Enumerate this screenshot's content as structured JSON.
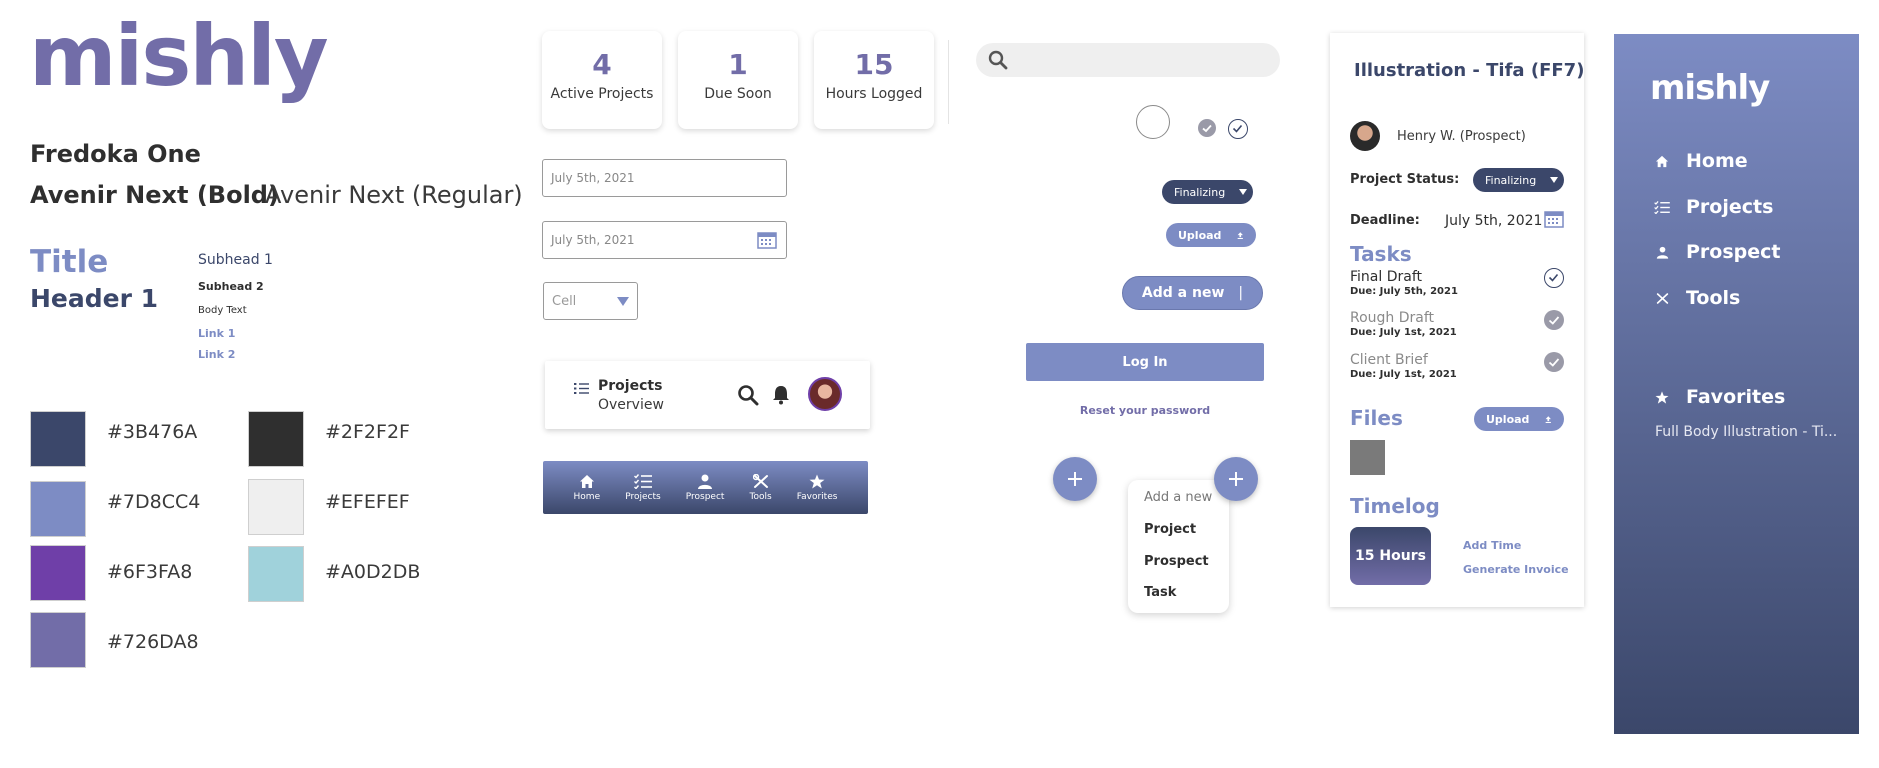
{
  "styleguide": {
    "logo": "mishly",
    "fonts": {
      "display": "Fredoka One",
      "bold": "Avenir Next (Bold)",
      "regular": "Avenir Next (Regular)"
    },
    "type": {
      "title": "Title",
      "header1": "Header 1",
      "subhead1": "Subhead 1",
      "subhead2": "Subhead 2",
      "body": "Body Text",
      "link1": "Link 1",
      "link2": "Link 2"
    },
    "colors": [
      {
        "hex": "#3B476A",
        "label": "#3B476A"
      },
      {
        "hex": "#7D8CC4",
        "label": "#7D8CC4"
      },
      {
        "hex": "#6F3FA8",
        "label": "#6F3FA8"
      },
      {
        "hex": "#726DA8",
        "label": "#726DA8"
      },
      {
        "hex": "#2F2F2F",
        "label": "#2F2F2F"
      },
      {
        "hex": "#EFEFEF",
        "label": "#EFEFEF"
      },
      {
        "hex": "#A0D2DB",
        "label": "#A0D2DB"
      }
    ]
  },
  "stats": [
    {
      "value": "4",
      "label": "Active Projects"
    },
    {
      "value": "1",
      "label": "Due Soon"
    },
    {
      "value": "15",
      "label": "Hours Logged"
    }
  ],
  "inputs": {
    "date_value": "July 5th, 2021",
    "date_picker_value": "July 5th, 2021",
    "select_value": "Cell"
  },
  "mobile_header": {
    "title": "Projects",
    "subtitle": "Overview"
  },
  "bottom_nav": [
    {
      "label": "Home",
      "icon": "home-icon"
    },
    {
      "label": "Projects",
      "icon": "list-icon"
    },
    {
      "label": "Prospect",
      "icon": "person-icon"
    },
    {
      "label": "Tools",
      "icon": "tools-icon"
    },
    {
      "label": "Favorites",
      "icon": "star-icon"
    }
  ],
  "components": {
    "status_pill": "Finalizing",
    "upload_pill": "Upload",
    "add_new_button": "Add a new",
    "login_button": "Log In",
    "reset_link": "Reset your password",
    "menu": {
      "header": "Add a new",
      "items": [
        "Project",
        "Prospect",
        "Task"
      ]
    }
  },
  "detail": {
    "title": "Illustration - Tifa (FF7)",
    "client": "Henry W. (Prospect)",
    "status_label": "Project Status:",
    "status_value": "Finalizing",
    "deadline_label": "Deadline:",
    "deadline_value": "July 5th, 2021",
    "tasks_heading": "Tasks",
    "tasks": [
      {
        "name": "Final Draft",
        "due": "Due: July 5th, 2021",
        "done": false
      },
      {
        "name": "Rough Draft",
        "due": "Due: July 1st, 2021",
        "done": true
      },
      {
        "name": "Client Brief",
        "due": "Due: July 1st, 2021",
        "done": true
      }
    ],
    "files_heading": "Files",
    "upload_label": "Upload",
    "timelog_heading": "Timelog",
    "hours": "15 Hours",
    "add_time": "Add Time",
    "generate_invoice": "Generate Invoice"
  },
  "sidebar": {
    "logo": "mishly",
    "items": [
      {
        "label": "Home",
        "icon": "home-icon"
      },
      {
        "label": "Projects",
        "icon": "list-icon"
      },
      {
        "label": "Prospect",
        "icon": "person-icon"
      },
      {
        "label": "Tools",
        "icon": "tools-icon"
      }
    ],
    "favorites_label": "Favorites",
    "favorite_item": "Full Body Illustration - Ti..."
  }
}
